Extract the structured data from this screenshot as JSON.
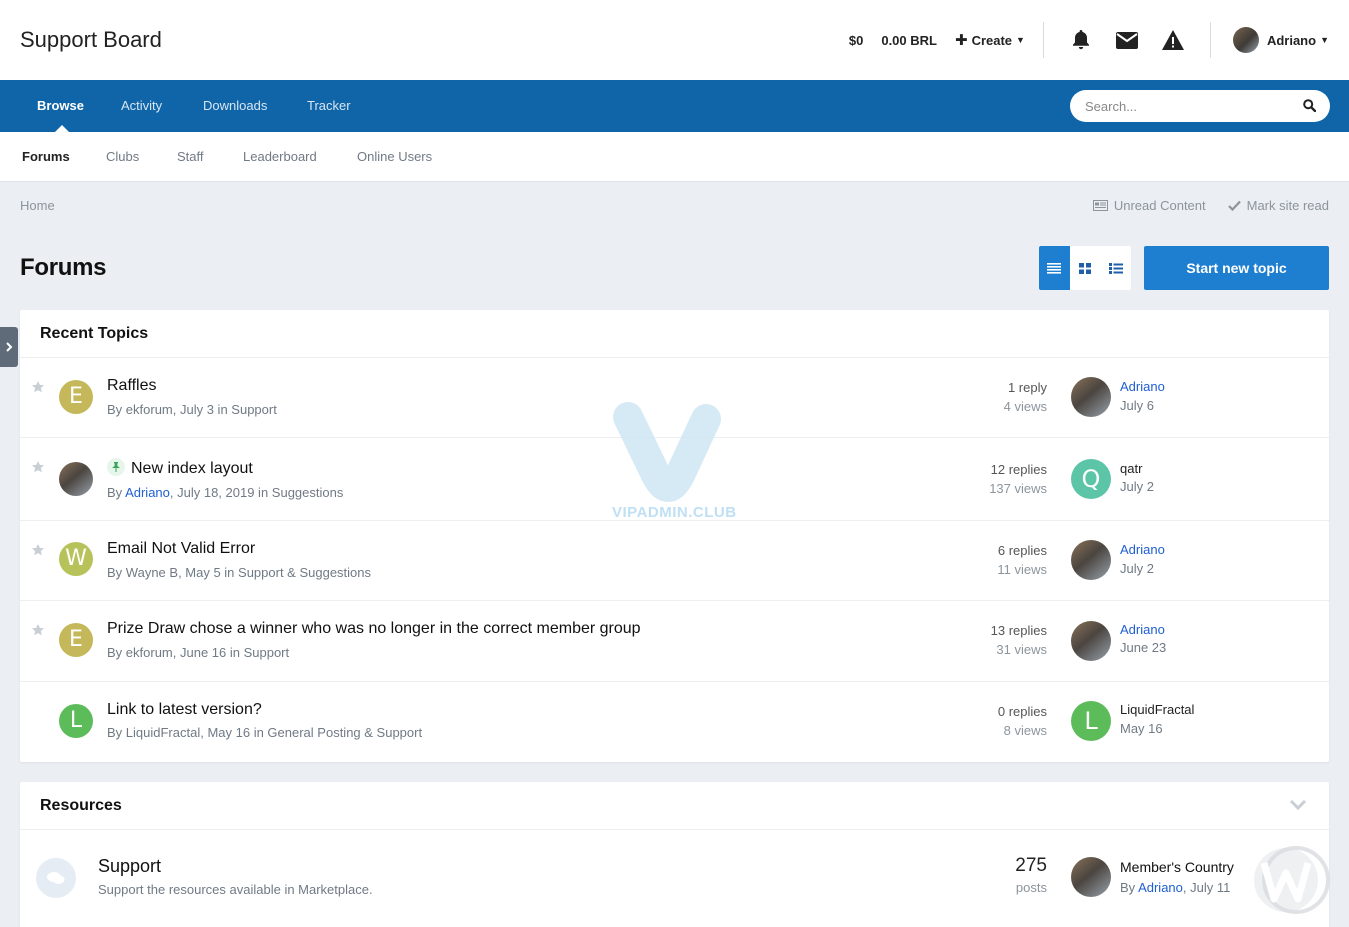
{
  "header": {
    "site_title": "Support Board",
    "balance_usd": "$0",
    "balance_brl": "0.00 BRL",
    "create_label": "Create",
    "icons": [
      "bell-icon",
      "envelope-icon",
      "warning-icon"
    ],
    "user_name": "Adriano"
  },
  "nav": {
    "items": [
      "Browse",
      "Activity",
      "Downloads",
      "Tracker"
    ],
    "active": "Browse",
    "search_placeholder": "Search..."
  },
  "subnav": {
    "items": [
      "Forums",
      "Clubs",
      "Staff",
      "Leaderboard",
      "Online Users"
    ],
    "active": "Forums"
  },
  "breadcrumb": {
    "home": "Home",
    "unread": "Unread Content",
    "mark_read": "Mark site read"
  },
  "page": {
    "title": "Forums",
    "start_topic": "Start new topic"
  },
  "recent": {
    "heading": "Recent Topics",
    "topics": [
      {
        "title": "Raffles",
        "by": "By ",
        "author": "ekforum",
        "meta": ", July 3 in Support",
        "replies": "1 reply",
        "views": "4 views",
        "avatar_letter": "E",
        "avatar_color": "#c4b85a",
        "last_user": "Adriano",
        "last_date": "July 6"
      },
      {
        "title": "New index layout",
        "by": "By ",
        "author": "Adriano",
        "meta": ", July 18, 2019 in Suggestions",
        "replies": "12 replies",
        "views": "137 views",
        "avatar_letter": "",
        "avatar_color": "",
        "last_user": "qatr",
        "last_date": "July 2",
        "last_letter": "Q",
        "last_color": "#5cc5a8"
      },
      {
        "title": "Email Not Valid Error",
        "by": "By ",
        "author": "Wayne B",
        "meta": ", May 5 in Support & Suggestions",
        "replies": "6 replies",
        "views": "11 views",
        "avatar_letter": "W",
        "avatar_color": "#b8c25a",
        "last_user": "Adriano",
        "last_date": "July 2"
      },
      {
        "title": "Prize Draw chose a winner who was no longer in the correct member group",
        "by": "By ",
        "author": "ekforum",
        "meta": ", June 16 in Support",
        "replies": "13 replies",
        "views": "31 views",
        "avatar_letter": "E",
        "avatar_color": "#c4b85a",
        "last_user": "Adriano",
        "last_date": "June 23"
      },
      {
        "title": "Link to latest version?",
        "by": "By ",
        "author": "LiquidFractal",
        "meta": ", May 16 in General Posting & Support",
        "replies": "0 replies",
        "views": "8 views",
        "avatar_letter": "L",
        "avatar_color": "#5cbc5a",
        "last_user": "LiquidFractal",
        "last_date": "May 16",
        "last_letter": "L",
        "last_color": "#5cbc5a"
      }
    ]
  },
  "resources": {
    "heading": "Resources",
    "forum_title": "Support",
    "forum_desc": "Support the resources available in Marketplace.",
    "count": "275",
    "count_label": "posts",
    "last_title": "Member's Country",
    "last_by": "By ",
    "last_user": "Adriano",
    "last_date": ", July 11"
  },
  "watermark": {
    "text": "VIPADMIN.CLUB"
  }
}
